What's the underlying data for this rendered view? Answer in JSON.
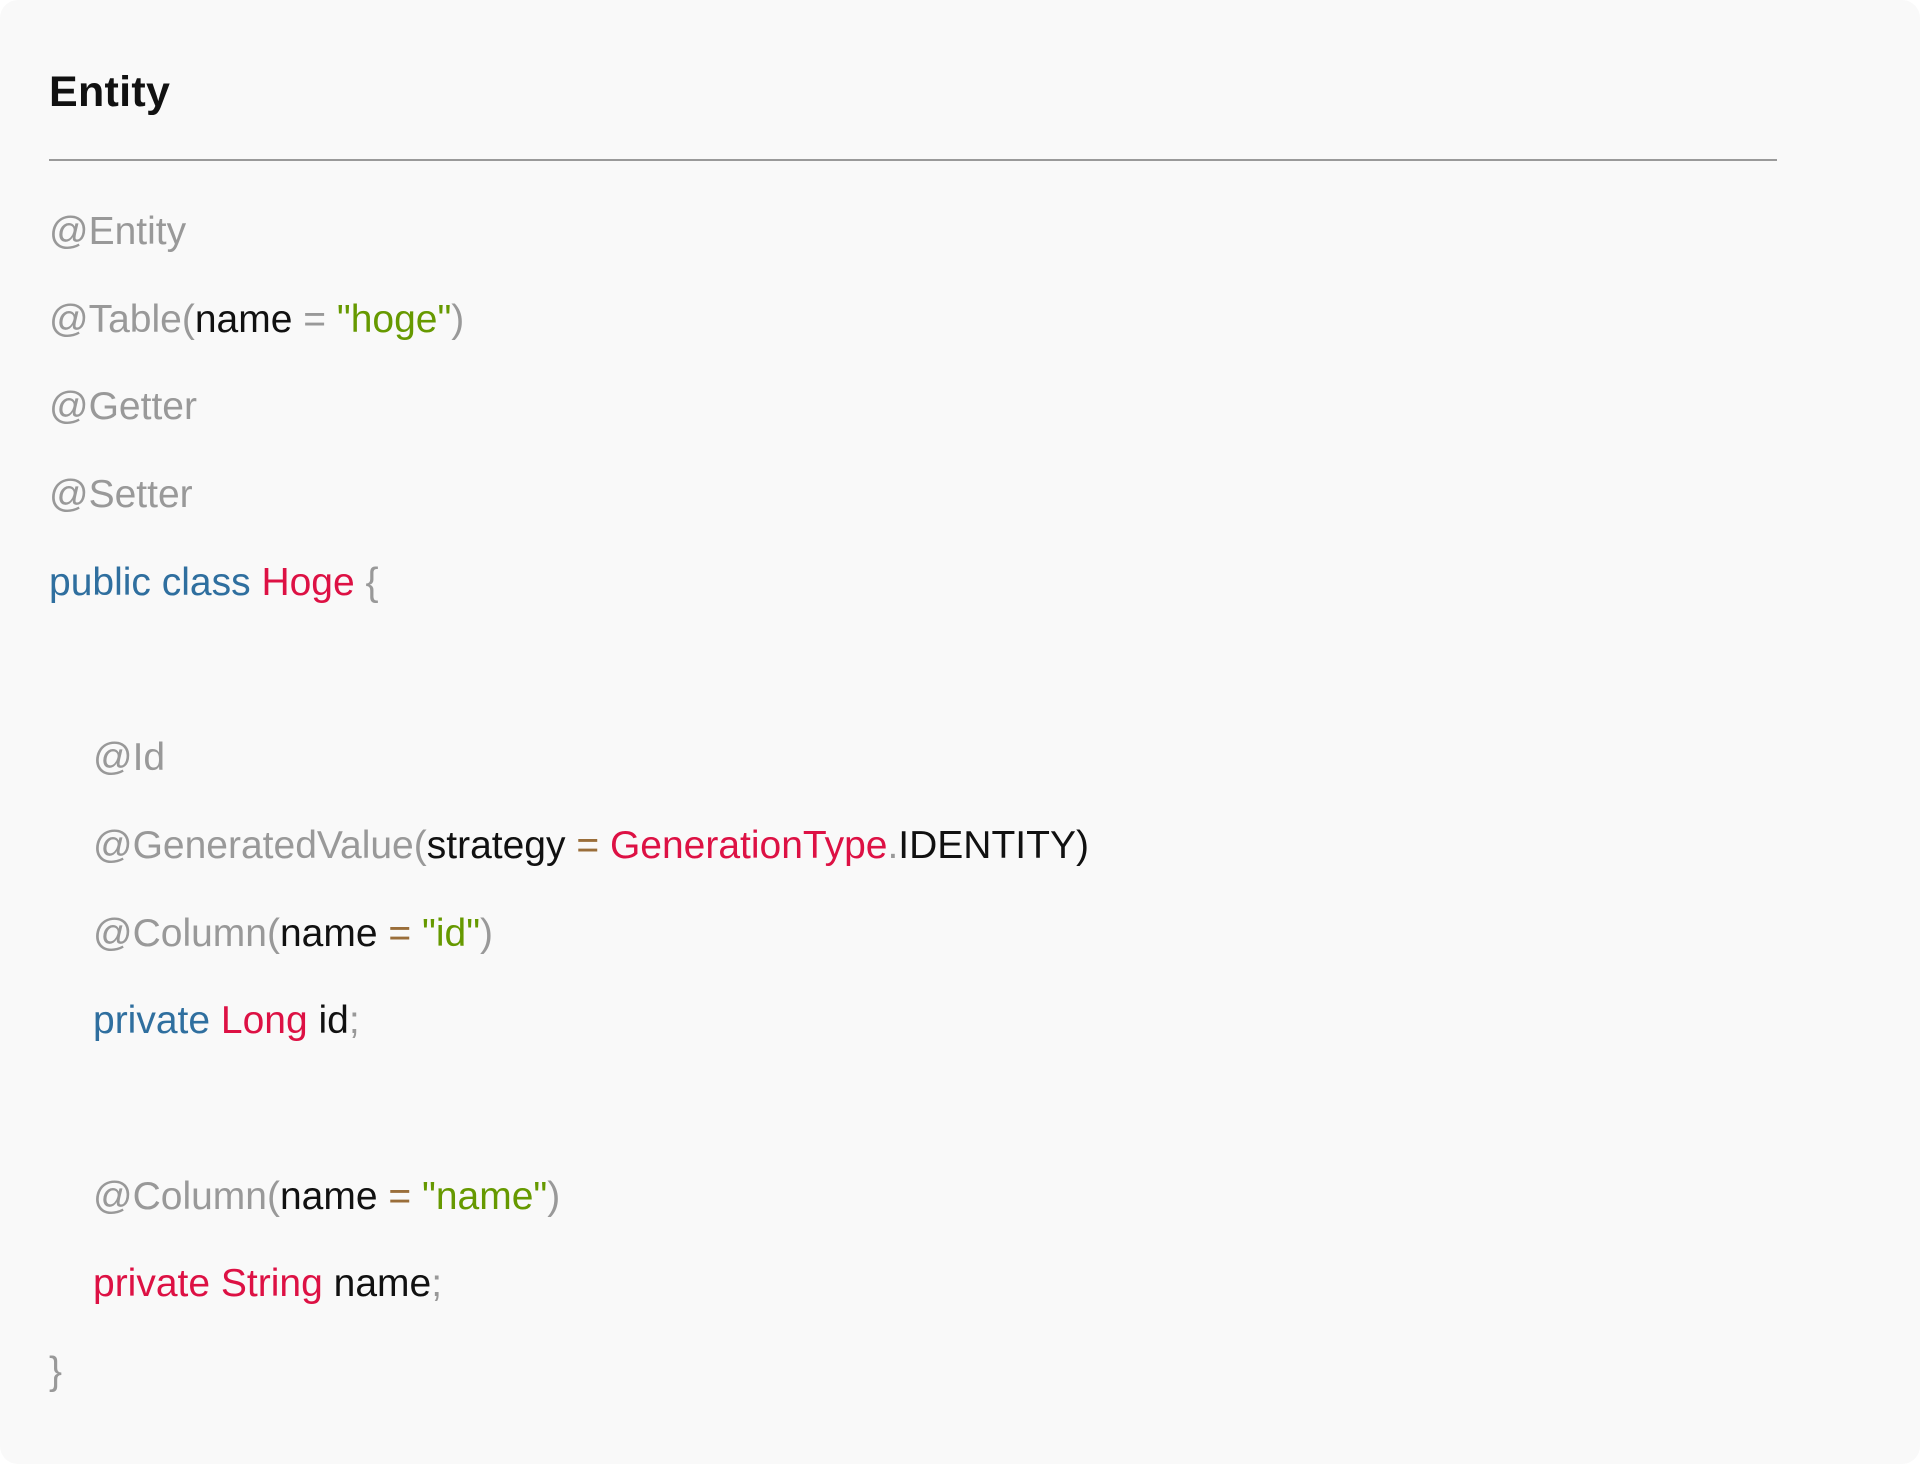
{
  "heading": "Entity",
  "code_lines": [
    {
      "indent": false,
      "tokens": [
        {
          "t": "@Entity",
          "k": "anno"
        }
      ]
    },
    {
      "indent": false,
      "tokens": [
        {
          "t": "@Table",
          "k": "anno"
        },
        {
          "t": "(",
          "k": "punct"
        },
        {
          "t": "name",
          "k": "ident"
        },
        {
          "t": " = ",
          "k": "punct"
        },
        {
          "t": "\"hoge\"",
          "k": "string"
        },
        {
          "t": ")",
          "k": "punct"
        }
      ]
    },
    {
      "indent": false,
      "tokens": [
        {
          "t": "@Getter",
          "k": "anno"
        }
      ]
    },
    {
      "indent": false,
      "tokens": [
        {
          "t": "@Setter",
          "k": "anno"
        }
      ]
    },
    {
      "indent": false,
      "tokens": [
        {
          "t": "public",
          "k": "keyword"
        },
        {
          "t": " ",
          "k": "ident"
        },
        {
          "t": "class",
          "k": "keyword"
        },
        {
          "t": " ",
          "k": "ident"
        },
        {
          "t": "Hoge",
          "k": "type"
        },
        {
          "t": " {",
          "k": "punct"
        }
      ]
    },
    {
      "indent": false,
      "tokens": []
    },
    {
      "indent": true,
      "tokens": [
        {
          "t": "@Id",
          "k": "anno"
        }
      ]
    },
    {
      "indent": true,
      "tokens": [
        {
          "t": "@GeneratedValue",
          "k": "anno"
        },
        {
          "t": "(",
          "k": "punct"
        },
        {
          "t": "strategy",
          "k": "ident"
        },
        {
          "t": " = ",
          "k": "op"
        },
        {
          "t": "GenerationType",
          "k": "type"
        },
        {
          "t": ".",
          "k": "punct"
        },
        {
          "t": "IDENTITY)",
          "k": "ident"
        }
      ]
    },
    {
      "indent": true,
      "tokens": [
        {
          "t": "@Column",
          "k": "anno"
        },
        {
          "t": "(",
          "k": "punct"
        },
        {
          "t": "name",
          "k": "ident"
        },
        {
          "t": " = ",
          "k": "op"
        },
        {
          "t": "\"id\"",
          "k": "string"
        },
        {
          "t": ")",
          "k": "punct"
        }
      ]
    },
    {
      "indent": true,
      "tokens": [
        {
          "t": "private",
          "k": "keyword"
        },
        {
          "t": " ",
          "k": "ident"
        },
        {
          "t": "Long",
          "k": "type"
        },
        {
          "t": " id",
          "k": "ident"
        },
        {
          "t": ";",
          "k": "punct"
        }
      ]
    },
    {
      "indent": false,
      "tokens": []
    },
    {
      "indent": true,
      "tokens": [
        {
          "t": "@Column",
          "k": "anno"
        },
        {
          "t": "(",
          "k": "punct"
        },
        {
          "t": "name",
          "k": "ident"
        },
        {
          "t": " = ",
          "k": "op"
        },
        {
          "t": "\"name\"",
          "k": "string"
        },
        {
          "t": ")",
          "k": "punct"
        }
      ]
    },
    {
      "indent": true,
      "tokens": [
        {
          "t": "private",
          "k": "type"
        },
        {
          "t": " ",
          "k": "ident"
        },
        {
          "t": "String",
          "k": "type"
        },
        {
          "t": " name",
          "k": "ident"
        },
        {
          "t": ";",
          "k": "punct"
        }
      ]
    },
    {
      "indent": false,
      "tokens": [
        {
          "t": "}",
          "k": "punct"
        }
      ]
    }
  ]
}
